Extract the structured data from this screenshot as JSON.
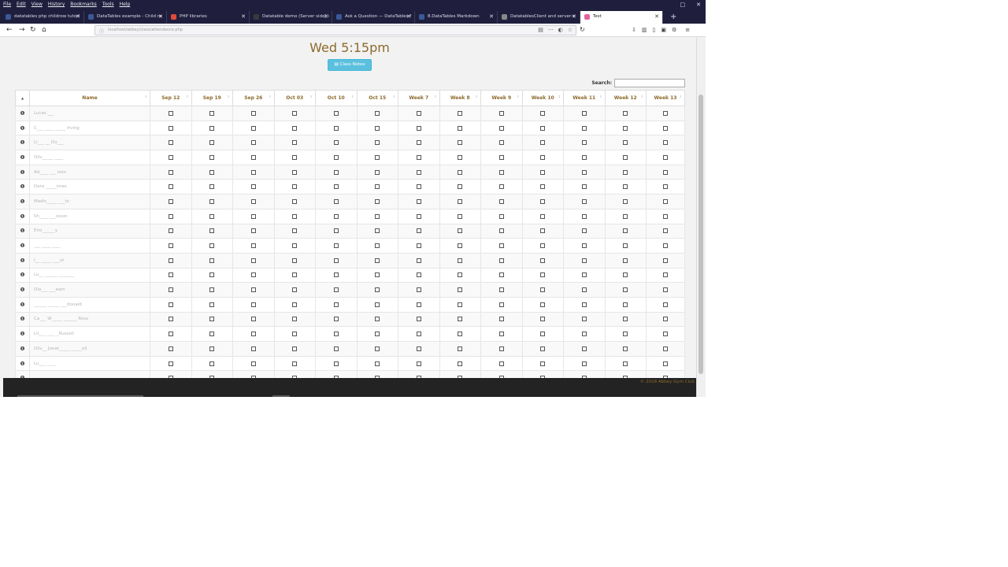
{
  "menu": [
    "File",
    "Edit",
    "View",
    "History",
    "Bookmarks",
    "Tools",
    "Help"
  ],
  "tabs": [
    {
      "title": "datatables php childrow tutori",
      "color": "#3b5998"
    },
    {
      "title": "DataTables example - Child ro",
      "color": "#3b5998"
    },
    {
      "title": "PHP libraries",
      "color": "#e2493b"
    },
    {
      "title": "Datatable demo (Server side) i",
      "color": "#3a3a3a"
    },
    {
      "title": "Ask a Question — DataTables f",
      "color": "#3b5998"
    },
    {
      "title": "8.DataTables Markdown",
      "color": "#3b5998"
    },
    {
      "title": "DatatablesClient and server-s",
      "color": "#888888"
    },
    {
      "title": "Test",
      "color": "#e55fa0"
    }
  ],
  "url": "localhost/abbey/class/attendance.php",
  "page": {
    "time": "Wed 5:15pm",
    "notes_button": "Class Notes",
    "search_label": "Search:",
    "columns": [
      "Name",
      "Sep 12",
      "Sep 19",
      "Sep 26",
      "Oct 03",
      "Oct 10",
      "Oct 15",
      "Week 7",
      "Week 8",
      "Week 9",
      "Week 10",
      "Week 11",
      "Week 12",
      "Week 13"
    ],
    "rows": [
      {
        "name": "Lucas ___"
      },
      {
        "name": "C___ ____ _____ Irving"
      },
      {
        "name": "Li___ __ Du___"
      },
      {
        "name": "Oliv_____ ____"
      },
      {
        "name": "Ad____ ___ ison"
      },
      {
        "name": "Dara _____imes"
      },
      {
        "name": "Madis_____ ___ts"
      },
      {
        "name": "Sh____ ___ieson"
      },
      {
        "name": "Emi______y"
      },
      {
        "name": "___ ____ ____"
      },
      {
        "name": "I__ _____ ___ut"
      },
      {
        "name": "Lu__ ______ _______"
      },
      {
        "name": "Ola___ ___eam"
      },
      {
        "name": "______ _____ ___donald"
      },
      {
        "name": "Ca___ W_____ ______ Ross"
      },
      {
        "name": "Lil___ ____ _Russell"
      },
      {
        "name": "Oliv__ Jonat_____ _____ell"
      },
      {
        "name": "Lu___ ____"
      },
      {
        "name": "______ _____ _____ ______"
      }
    ],
    "footer": "© 2018 Abbey Gym Club"
  }
}
